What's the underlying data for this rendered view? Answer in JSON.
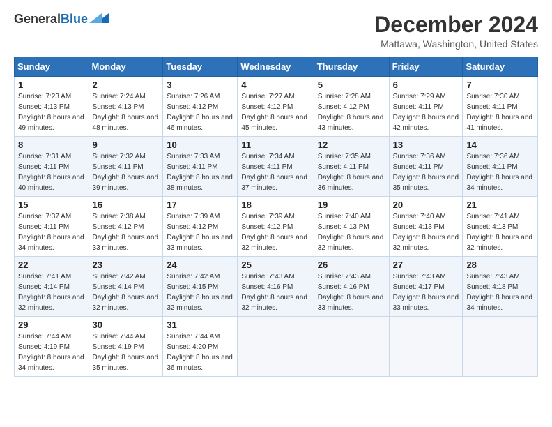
{
  "logo": {
    "line1": "General",
    "line2": "Blue",
    "icon_color": "#1a6bb5"
  },
  "header": {
    "title": "December 2024",
    "subtitle": "Mattawa, Washington, United States"
  },
  "weekdays": [
    "Sunday",
    "Monday",
    "Tuesday",
    "Wednesday",
    "Thursday",
    "Friday",
    "Saturday"
  ],
  "weeks": [
    [
      {
        "day": "1",
        "sunrise": "Sunrise: 7:23 AM",
        "sunset": "Sunset: 4:13 PM",
        "daylight": "Daylight: 8 hours and 49 minutes."
      },
      {
        "day": "2",
        "sunrise": "Sunrise: 7:24 AM",
        "sunset": "Sunset: 4:13 PM",
        "daylight": "Daylight: 8 hours and 48 minutes."
      },
      {
        "day": "3",
        "sunrise": "Sunrise: 7:26 AM",
        "sunset": "Sunset: 4:12 PM",
        "daylight": "Daylight: 8 hours and 46 minutes."
      },
      {
        "day": "4",
        "sunrise": "Sunrise: 7:27 AM",
        "sunset": "Sunset: 4:12 PM",
        "daylight": "Daylight: 8 hours and 45 minutes."
      },
      {
        "day": "5",
        "sunrise": "Sunrise: 7:28 AM",
        "sunset": "Sunset: 4:12 PM",
        "daylight": "Daylight: 8 hours and 43 minutes."
      },
      {
        "day": "6",
        "sunrise": "Sunrise: 7:29 AM",
        "sunset": "Sunset: 4:11 PM",
        "daylight": "Daylight: 8 hours and 42 minutes."
      },
      {
        "day": "7",
        "sunrise": "Sunrise: 7:30 AM",
        "sunset": "Sunset: 4:11 PM",
        "daylight": "Daylight: 8 hours and 41 minutes."
      }
    ],
    [
      {
        "day": "8",
        "sunrise": "Sunrise: 7:31 AM",
        "sunset": "Sunset: 4:11 PM",
        "daylight": "Daylight: 8 hours and 40 minutes."
      },
      {
        "day": "9",
        "sunrise": "Sunrise: 7:32 AM",
        "sunset": "Sunset: 4:11 PM",
        "daylight": "Daylight: 8 hours and 39 minutes."
      },
      {
        "day": "10",
        "sunrise": "Sunrise: 7:33 AM",
        "sunset": "Sunset: 4:11 PM",
        "daylight": "Daylight: 8 hours and 38 minutes."
      },
      {
        "day": "11",
        "sunrise": "Sunrise: 7:34 AM",
        "sunset": "Sunset: 4:11 PM",
        "daylight": "Daylight: 8 hours and 37 minutes."
      },
      {
        "day": "12",
        "sunrise": "Sunrise: 7:35 AM",
        "sunset": "Sunset: 4:11 PM",
        "daylight": "Daylight: 8 hours and 36 minutes."
      },
      {
        "day": "13",
        "sunrise": "Sunrise: 7:36 AM",
        "sunset": "Sunset: 4:11 PM",
        "daylight": "Daylight: 8 hours and 35 minutes."
      },
      {
        "day": "14",
        "sunrise": "Sunrise: 7:36 AM",
        "sunset": "Sunset: 4:11 PM",
        "daylight": "Daylight: 8 hours and 34 minutes."
      }
    ],
    [
      {
        "day": "15",
        "sunrise": "Sunrise: 7:37 AM",
        "sunset": "Sunset: 4:11 PM",
        "daylight": "Daylight: 8 hours and 34 minutes."
      },
      {
        "day": "16",
        "sunrise": "Sunrise: 7:38 AM",
        "sunset": "Sunset: 4:12 PM",
        "daylight": "Daylight: 8 hours and 33 minutes."
      },
      {
        "day": "17",
        "sunrise": "Sunrise: 7:39 AM",
        "sunset": "Sunset: 4:12 PM",
        "daylight": "Daylight: 8 hours and 33 minutes."
      },
      {
        "day": "18",
        "sunrise": "Sunrise: 7:39 AM",
        "sunset": "Sunset: 4:12 PM",
        "daylight": "Daylight: 8 hours and 32 minutes."
      },
      {
        "day": "19",
        "sunrise": "Sunrise: 7:40 AM",
        "sunset": "Sunset: 4:13 PM",
        "daylight": "Daylight: 8 hours and 32 minutes."
      },
      {
        "day": "20",
        "sunrise": "Sunrise: 7:40 AM",
        "sunset": "Sunset: 4:13 PM",
        "daylight": "Daylight: 8 hours and 32 minutes."
      },
      {
        "day": "21",
        "sunrise": "Sunrise: 7:41 AM",
        "sunset": "Sunset: 4:13 PM",
        "daylight": "Daylight: 8 hours and 32 minutes."
      }
    ],
    [
      {
        "day": "22",
        "sunrise": "Sunrise: 7:41 AM",
        "sunset": "Sunset: 4:14 PM",
        "daylight": "Daylight: 8 hours and 32 minutes."
      },
      {
        "day": "23",
        "sunrise": "Sunrise: 7:42 AM",
        "sunset": "Sunset: 4:14 PM",
        "daylight": "Daylight: 8 hours and 32 minutes."
      },
      {
        "day": "24",
        "sunrise": "Sunrise: 7:42 AM",
        "sunset": "Sunset: 4:15 PM",
        "daylight": "Daylight: 8 hours and 32 minutes."
      },
      {
        "day": "25",
        "sunrise": "Sunrise: 7:43 AM",
        "sunset": "Sunset: 4:16 PM",
        "daylight": "Daylight: 8 hours and 32 minutes."
      },
      {
        "day": "26",
        "sunrise": "Sunrise: 7:43 AM",
        "sunset": "Sunset: 4:16 PM",
        "daylight": "Daylight: 8 hours and 33 minutes."
      },
      {
        "day": "27",
        "sunrise": "Sunrise: 7:43 AM",
        "sunset": "Sunset: 4:17 PM",
        "daylight": "Daylight: 8 hours and 33 minutes."
      },
      {
        "day": "28",
        "sunrise": "Sunrise: 7:43 AM",
        "sunset": "Sunset: 4:18 PM",
        "daylight": "Daylight: 8 hours and 34 minutes."
      }
    ],
    [
      {
        "day": "29",
        "sunrise": "Sunrise: 7:44 AM",
        "sunset": "Sunset: 4:19 PM",
        "daylight": "Daylight: 8 hours and 34 minutes."
      },
      {
        "day": "30",
        "sunrise": "Sunrise: 7:44 AM",
        "sunset": "Sunset: 4:19 PM",
        "daylight": "Daylight: 8 hours and 35 minutes."
      },
      {
        "day": "31",
        "sunrise": "Sunrise: 7:44 AM",
        "sunset": "Sunset: 4:20 PM",
        "daylight": "Daylight: 8 hours and 36 minutes."
      },
      null,
      null,
      null,
      null
    ]
  ]
}
